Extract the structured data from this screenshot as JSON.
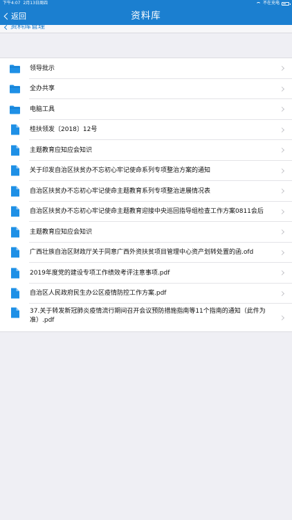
{
  "status_bar": {
    "time": "下午4:07",
    "date": "2月13日周四",
    "charge_status": "不在充电"
  },
  "nav": {
    "back_label": "返回",
    "title": "资料库"
  },
  "breadcrumb": {
    "label": "资料库管理"
  },
  "items": [
    {
      "label": "领导批示",
      "icon": "folder-icon",
      "type": "folder"
    },
    {
      "label": "全办共享",
      "icon": "folder-icon",
      "type": "folder"
    },
    {
      "label": "电脑工具",
      "icon": "folder-icon",
      "type": "folder"
    },
    {
      "label": "桂扶领发〔2018〕12号",
      "icon": "file-icon",
      "type": "file"
    },
    {
      "label": "主题教育应知应会知识",
      "icon": "file-icon",
      "type": "file"
    },
    {
      "label": "关于印发自治区扶贫办不忘初心牢记使命系列专项整治方案的通知",
      "icon": "file-icon",
      "type": "file"
    },
    {
      "label": "自治区扶贫办不忘初心牢记使命主题教育系列专项整治进展情况表",
      "icon": "file-icon",
      "type": "file"
    },
    {
      "label": "自治区扶贫办不忘初心牢记使命主题教育迎接中央巡回指导组检查工作方案0811会后",
      "icon": "file-icon",
      "type": "file"
    },
    {
      "label": "主题教育应知应会知识",
      "icon": "file-icon",
      "type": "file"
    },
    {
      "label": "广西壮族自治区财政厅关于同意广西外资扶贫项目管理中心资产划转处置的函.ofd",
      "icon": "file-icon",
      "type": "file"
    },
    {
      "label": "2019年度党的建设专项工作绩效考评注意事项.pdf",
      "icon": "file-icon",
      "type": "file"
    },
    {
      "label": "自治区人民政府民生办公区疫情防控工作方案.pdf",
      "icon": "file-icon",
      "type": "file"
    },
    {
      "label": "37.关于转发新冠肺炎疫情流行期间召开会议预防措施指南等11个指南的通知（此件为准）.pdf",
      "icon": "file-icon",
      "type": "file",
      "tall": true
    }
  ],
  "colors": {
    "accent": "#1b7fd0",
    "icon_blue": "#1e90e6",
    "background": "#efeff4"
  }
}
